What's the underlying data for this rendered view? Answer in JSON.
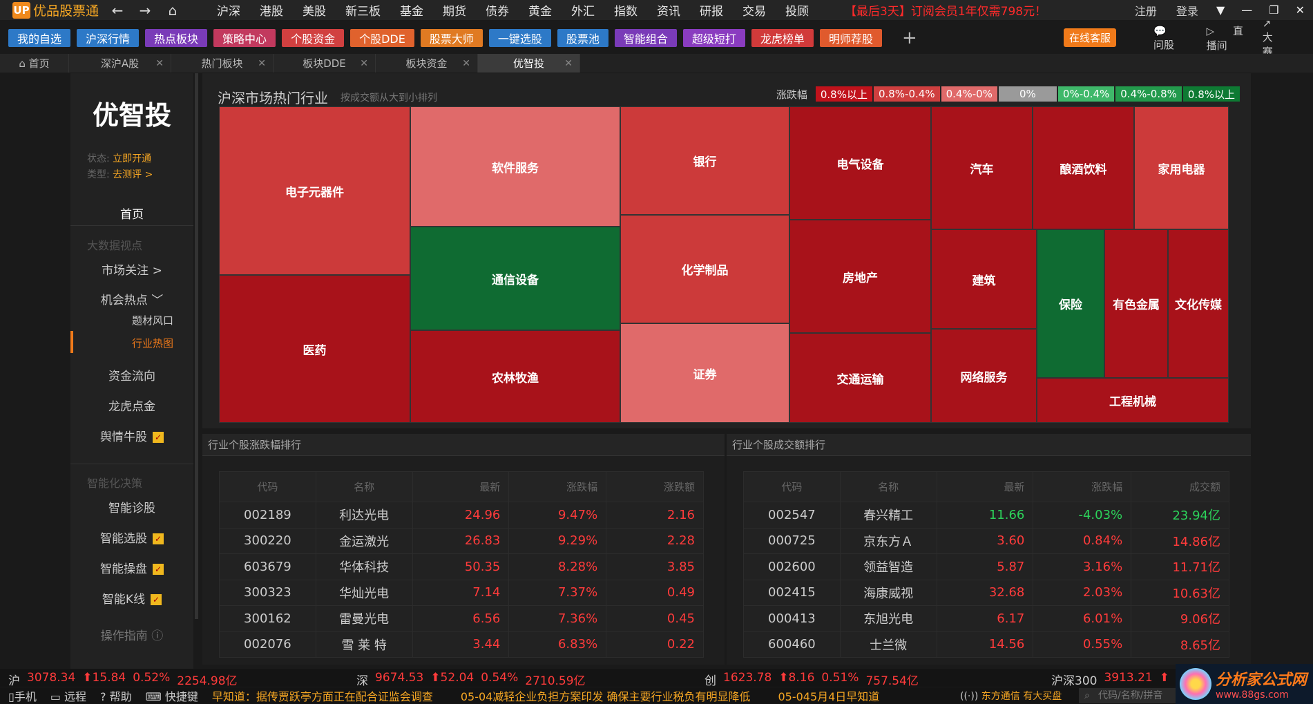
{
  "topbar": {
    "logo_text": "优品股票通",
    "menu": [
      "沪深",
      "港股",
      "美股",
      "新三板",
      "基金",
      "期货",
      "债券",
      "黄金",
      "外汇",
      "指数",
      "资讯",
      "研报",
      "交易",
      "投顾"
    ],
    "promo": "【最后3天】订阅会员1年仅需798元！",
    "register": "注册",
    "login": "登录"
  },
  "shortcuts": [
    {
      "label": "我的自选",
      "color": "#2d79c7"
    },
    {
      "label": "沪深行情",
      "color": "#2d79c7"
    },
    {
      "label": "热点板块",
      "color": "#7a3bb8"
    },
    {
      "label": "策略中心",
      "color": "#c2395e"
    },
    {
      "label": "个股资金",
      "color": "#d14040"
    },
    {
      "label": "个股DDE",
      "color": "#e0622d"
    },
    {
      "label": "股票大师",
      "color": "#e07a22"
    },
    {
      "label": "一键选股",
      "color": "#2d79c7"
    },
    {
      "label": "股票池",
      "color": "#2d79c7"
    },
    {
      "label": "智能组合",
      "color": "#7a3bb8"
    },
    {
      "label": "超级短打",
      "color": "#8a3cc0"
    },
    {
      "label": "龙虎榜单",
      "color": "#d13a3a"
    },
    {
      "label": "明师荐股",
      "color": "#e05a2d"
    }
  ],
  "toolbar_right": {
    "service": "在线客服",
    "tools": [
      "问股",
      "直播间",
      "大赛"
    ]
  },
  "tabs": [
    {
      "label": "首页",
      "active": false
    },
    {
      "label": "深沪A股",
      "active": false
    },
    {
      "label": "热门板块",
      "active": false
    },
    {
      "label": "板块DDE",
      "active": false
    },
    {
      "label": "板块资金",
      "active": false
    },
    {
      "label": "优智投",
      "active": true
    }
  ],
  "sidebar": {
    "brand": "优智投",
    "status_label": "状态:",
    "status_value": "立即开通",
    "type_label": "类型:",
    "type_value": "去测评 >",
    "home": "首页",
    "group1": "大数据视点",
    "items1": [
      "市场关注 >",
      "机会热点 ﹀",
      "题材风口",
      "行业热图",
      "资金流向",
      "龙虎点金",
      "舆情牛股"
    ],
    "group2": "智能化决策",
    "items2": [
      "智能诊股",
      "智能选股",
      "智能操盘",
      "智能K线"
    ],
    "guide": "操作指南"
  },
  "heatmap": {
    "title": "沪深市场热门行业",
    "subtitle": "按成交额从大到小排列",
    "legend_label": "涨跌幅",
    "legend": [
      {
        "label": "0.8%以上",
        "color": "#c1121b"
      },
      {
        "label": "0.8%-0.4%",
        "color": "#cf3f3f"
      },
      {
        "label": "0.4%-0%",
        "color": "#e06a6a"
      },
      {
        "label": "0%",
        "color": "#9a9a9a"
      },
      {
        "label": "0%-0.4%",
        "color": "#3fb86a"
      },
      {
        "label": "0.4%-0.8%",
        "color": "#239a4c"
      },
      {
        "label": "0.8%以上",
        "color": "#0e7a33"
      }
    ],
    "tiles": [
      "电子元器件",
      "医药",
      "软件服务",
      "通信设备",
      "农林牧渔",
      "银行",
      "化学制品",
      "证券",
      "电气设备",
      "房地产",
      "交通运输",
      "汽车",
      "建筑",
      "网络服务",
      "酿酒饮料",
      "家用电器",
      "保险",
      "有色金属",
      "文化传媒",
      "工程机械"
    ]
  },
  "left_table": {
    "title": "行业个股涨跌幅排行",
    "headers": [
      "代码",
      "名称",
      "最新",
      "涨跌幅",
      "涨跌额"
    ],
    "rows": [
      [
        "002189",
        "利达光电",
        "24.96",
        "9.47%",
        "2.16"
      ],
      [
        "300220",
        "金运激光",
        "26.83",
        "9.29%",
        "2.28"
      ],
      [
        "603679",
        "华体科技",
        "50.35",
        "8.28%",
        "3.85"
      ],
      [
        "300323",
        "华灿光电",
        "7.14",
        "7.37%",
        "0.49"
      ],
      [
        "300162",
        "雷曼光电",
        "6.56",
        "7.36%",
        "0.45"
      ],
      [
        "002076",
        "雪 莱 特",
        "3.44",
        "6.83%",
        "0.22"
      ]
    ]
  },
  "right_table": {
    "title": "行业个股成交额排行",
    "headers": [
      "代码",
      "名称",
      "最新",
      "涨跌幅",
      "成交额"
    ],
    "rows": [
      [
        "002547",
        "春兴精工",
        "11.66",
        "-4.03%",
        "23.94亿"
      ],
      [
        "000725",
        "京东方Ａ",
        "3.60",
        "0.84%",
        "14.86亿"
      ],
      [
        "002600",
        "领益智造",
        "5.87",
        "3.16%",
        "11.71亿"
      ],
      [
        "002415",
        "海康威视",
        "32.68",
        "2.03%",
        "10.63亿"
      ],
      [
        "000413",
        "东旭光电",
        "6.17",
        "6.01%",
        "9.06亿"
      ],
      [
        "600460",
        "士兰微",
        "14.56",
        "0.55%",
        "8.65亿"
      ]
    ]
  },
  "indices": [
    {
      "name": "沪",
      "value": "3078.34",
      "chg": "⬆15.84",
      "pct": "0.52%",
      "amt": "2254.98亿"
    },
    {
      "name": "深",
      "value": "9674.53",
      "chg": "⬆52.04",
      "pct": "0.54%",
      "amt": "2710.59亿"
    },
    {
      "name": "创",
      "value": "1623.78",
      "chg": "⬆8.16",
      "pct": "0.51%",
      "amt": "757.54亿"
    },
    {
      "name": "沪深300",
      "value": "3913.21",
      "chg": "⬆",
      "pct": "",
      "amt": ""
    }
  ],
  "news": {
    "buttons": [
      "手机",
      "远程",
      "帮助",
      "快捷键"
    ],
    "items": [
      "早知道：据传贾跃亭方面正在配合证监会调查",
      "05-04减轻企业负担方案印发 确保主要行业税负有明显降低",
      "05-045月4日早知道"
    ],
    "right1": "东方通信 有大买盘",
    "search_placeholder": "代码/名称/拼音"
  },
  "watermark": {
    "line1": "分析家公式网",
    "line2": "www.88gs.com"
  }
}
